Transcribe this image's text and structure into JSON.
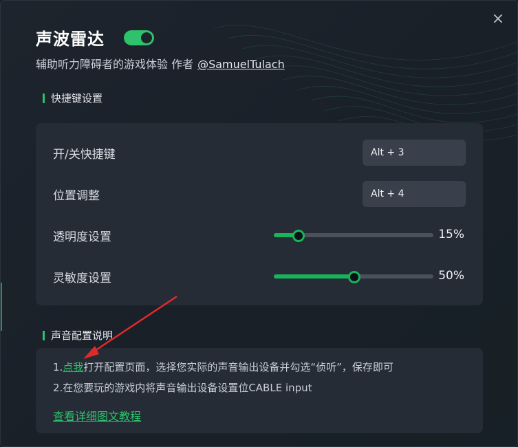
{
  "dialog": {
    "title": "声波雷达",
    "enabled": true,
    "subtitle": "辅助听力障碍者的游戏体验 作者",
    "author_link": "@SamuelTulach",
    "close_icon": "×"
  },
  "hotkeys_section": {
    "heading": "快捷键设置",
    "rows": [
      {
        "label": "开/关快捷键",
        "value": "Alt + 3"
      },
      {
        "label": "位置调整",
        "value": "Alt + 4"
      }
    ],
    "sliders": [
      {
        "label": "透明度设置",
        "value": "15%",
        "fraction": 0.15
      },
      {
        "label": "灵敏度设置",
        "value": "50%",
        "fraction": 0.5
      }
    ]
  },
  "audio_section": {
    "heading": "声音配置说明",
    "line1_prefix": "1.",
    "line1_link": "点我",
    "line1_rest": "打开配置页面，选择您实际的声音输出设备并勾选“侦听”，保存即可",
    "line2": "2.在您要玩的游戏内将声音输出设备设置位CABLE input",
    "tutorial_link": "查看详细图文教程"
  },
  "colors": {
    "accent": "#2dc26b",
    "annotation_arrow": "#e02a2a"
  }
}
